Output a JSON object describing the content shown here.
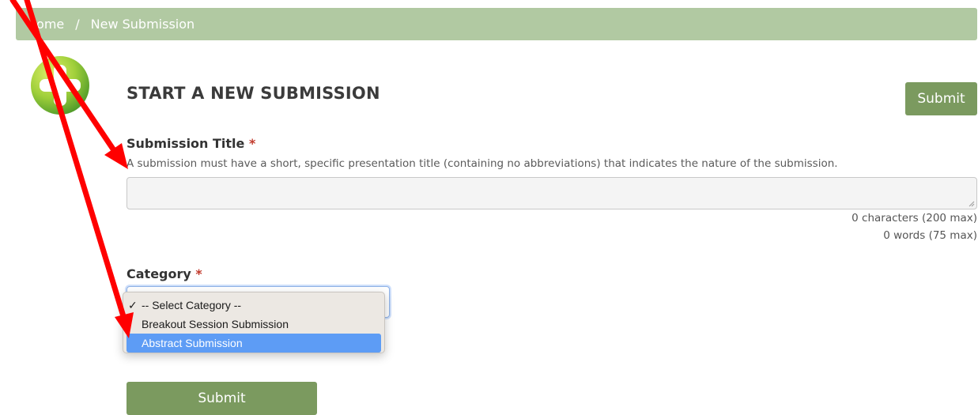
{
  "breadcrumb": {
    "home": "Home",
    "separator": "/",
    "current": "New Submission"
  },
  "page": {
    "title": "START A NEW SUBMISSION",
    "submit_top": "Submit",
    "submit_bottom": "Submit"
  },
  "submission_title": {
    "label": "Submission Title",
    "required_mark": "*",
    "help": "A submission must have a short, specific presentation title (containing no abbreviations) that indicates the nature of the submission.",
    "value": "",
    "char_count": "0 characters (200 max)",
    "word_count": "0 words (75 max)"
  },
  "category": {
    "label": "Category",
    "required_mark": "*",
    "check_mark": "✓",
    "options": [
      "-- Select Category --",
      "Breakout Session Submission",
      "Abstract Submission"
    ],
    "selected_index": 0,
    "highlighted_index": 2
  },
  "colors": {
    "breadcrumb_bg": "#b1c9a2",
    "button_bg": "#7b9a5f",
    "required": "#c23a2c",
    "highlight": "#5d9cf5",
    "annotation_arrow": "#ff0000"
  },
  "icons": {
    "logo": "plus-circle-icon",
    "arrows": "annotation-arrow"
  }
}
